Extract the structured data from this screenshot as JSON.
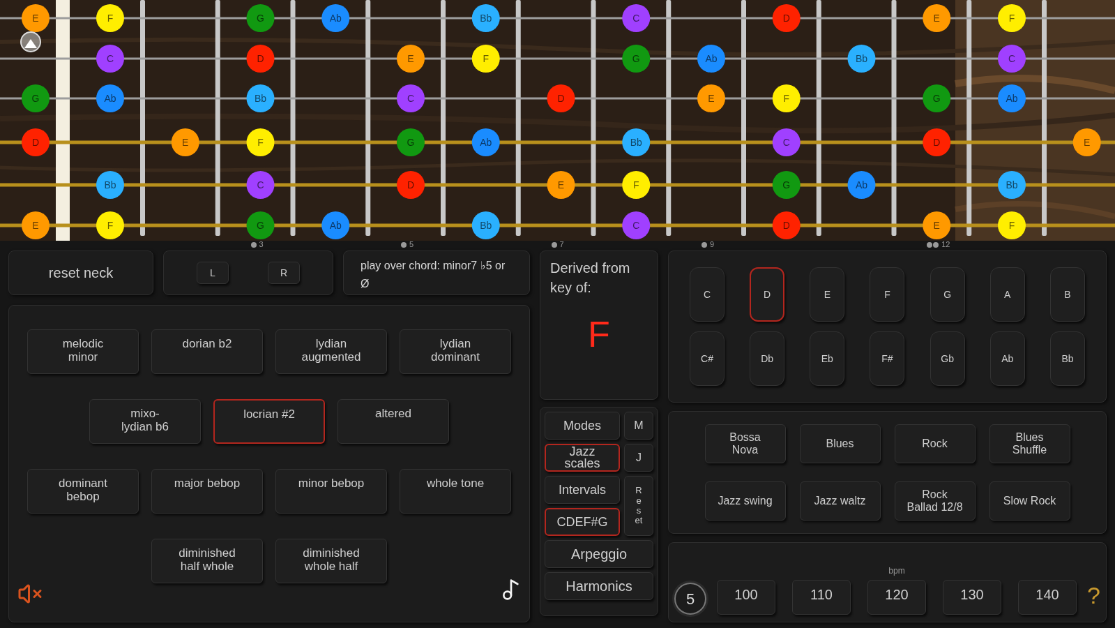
{
  "fretboard": {
    "strings": [
      {
        "kind": "plain",
        "cells": [
          {
            "kind": "note",
            "name": "E",
            "color": "#ff9900"
          },
          {
            "kind": "note",
            "name": "F",
            "color": "#ffee00"
          },
          {
            "kind": "empty"
          },
          {
            "kind": "note",
            "name": "G",
            "color": "#119911"
          },
          {
            "kind": "note",
            "name": "Ab",
            "color": "#1a8cff"
          },
          {
            "kind": "empty"
          },
          {
            "kind": "note",
            "name": "Bb",
            "color": "#2ab0ff"
          },
          {
            "kind": "empty"
          },
          {
            "kind": "note",
            "name": "C",
            "color": "#a040ff"
          },
          {
            "kind": "empty"
          },
          {
            "kind": "note",
            "name": "D",
            "color": "#ff2200"
          },
          {
            "kind": "empty"
          },
          {
            "kind": "note",
            "name": "E",
            "color": "#ff9900"
          },
          {
            "kind": "note",
            "name": "F",
            "color": "#ffee00"
          }
        ]
      },
      {
        "kind": "plain",
        "cells": [
          {
            "kind": "empty"
          },
          {
            "kind": "note",
            "name": "C",
            "color": "#a040ff"
          },
          {
            "kind": "empty"
          },
          {
            "kind": "note",
            "name": "D",
            "color": "#ff2200"
          },
          {
            "kind": "empty"
          },
          {
            "kind": "note",
            "name": "E",
            "color": "#ff9900"
          },
          {
            "kind": "note",
            "name": "F",
            "color": "#ffee00"
          },
          {
            "kind": "empty"
          },
          {
            "kind": "note",
            "name": "G",
            "color": "#119911"
          },
          {
            "kind": "note",
            "name": "Ab",
            "color": "#1a8cff"
          },
          {
            "kind": "empty"
          },
          {
            "kind": "note",
            "name": "Bb",
            "color": "#2ab0ff"
          },
          {
            "kind": "empty"
          },
          {
            "kind": "note",
            "name": "C",
            "color": "#a040ff"
          }
        ]
      },
      {
        "kind": "plain",
        "cells": [
          {
            "kind": "note",
            "name": "G",
            "color": "#119911"
          },
          {
            "kind": "note",
            "name": "Ab",
            "color": "#1a8cff"
          },
          {
            "kind": "empty"
          },
          {
            "kind": "note",
            "name": "Bb",
            "color": "#2ab0ff"
          },
          {
            "kind": "empty"
          },
          {
            "kind": "note",
            "name": "C",
            "color": "#a040ff"
          },
          {
            "kind": "empty"
          },
          {
            "kind": "note",
            "name": "D",
            "color": "#ff2200"
          },
          {
            "kind": "empty"
          },
          {
            "kind": "note",
            "name": "E",
            "color": "#ff9900"
          },
          {
            "kind": "note",
            "name": "F",
            "color": "#ffee00"
          },
          {
            "kind": "empty"
          },
          {
            "kind": "note",
            "name": "G",
            "color": "#119911"
          },
          {
            "kind": "note",
            "name": "Ab",
            "color": "#1a8cff"
          }
        ]
      },
      {
        "kind": "wound",
        "cells": [
          {
            "kind": "note",
            "name": "D",
            "color": "#ff2200"
          },
          {
            "kind": "empty"
          },
          {
            "kind": "note",
            "name": "E",
            "color": "#ff9900"
          },
          {
            "kind": "note",
            "name": "F",
            "color": "#ffee00"
          },
          {
            "kind": "empty"
          },
          {
            "kind": "note",
            "name": "G",
            "color": "#119911"
          },
          {
            "kind": "note",
            "name": "Ab",
            "color": "#1a8cff"
          },
          {
            "kind": "empty"
          },
          {
            "kind": "note",
            "name": "Bb",
            "color": "#2ab0ff"
          },
          {
            "kind": "empty"
          },
          {
            "kind": "note",
            "name": "C",
            "color": "#a040ff"
          },
          {
            "kind": "empty"
          },
          {
            "kind": "note",
            "name": "D",
            "color": "#ff2200"
          },
          {
            "kind": "empty"
          },
          {
            "kind": "note",
            "name": "E",
            "color": "#ff9900"
          }
        ]
      },
      {
        "kind": "wound",
        "cells": [
          {
            "kind": "empty"
          },
          {
            "kind": "note",
            "name": "Bb",
            "color": "#2ab0ff"
          },
          {
            "kind": "empty"
          },
          {
            "kind": "note",
            "name": "C",
            "color": "#a040ff"
          },
          {
            "kind": "empty"
          },
          {
            "kind": "note",
            "name": "D",
            "color": "#ff2200"
          },
          {
            "kind": "empty"
          },
          {
            "kind": "note",
            "name": "E",
            "color": "#ff9900"
          },
          {
            "kind": "note",
            "name": "F",
            "color": "#ffee00"
          },
          {
            "kind": "empty"
          },
          {
            "kind": "note",
            "name": "G",
            "color": "#119911"
          },
          {
            "kind": "note",
            "name": "Ab",
            "color": "#1a8cff"
          },
          {
            "kind": "empty"
          },
          {
            "kind": "note",
            "name": "Bb",
            "color": "#2ab0ff"
          }
        ]
      },
      {
        "kind": "wound",
        "cells": [
          {
            "kind": "note",
            "name": "E",
            "color": "#ff9900"
          },
          {
            "kind": "note",
            "name": "F",
            "color": "#ffee00"
          },
          {
            "kind": "empty"
          },
          {
            "kind": "note",
            "name": "G",
            "color": "#119911"
          },
          {
            "kind": "note",
            "name": "Ab",
            "color": "#1a8cff"
          },
          {
            "kind": "empty"
          },
          {
            "kind": "note",
            "name": "Bb",
            "color": "#2ab0ff"
          },
          {
            "kind": "empty"
          },
          {
            "kind": "note",
            "name": "C",
            "color": "#a040ff"
          },
          {
            "kind": "empty"
          },
          {
            "kind": "note",
            "name": "D",
            "color": "#ff2200"
          },
          {
            "kind": "empty"
          },
          {
            "kind": "note",
            "name": "E",
            "color": "#ff9900"
          },
          {
            "kind": "note",
            "name": "F",
            "color": "#ffee00"
          }
        ]
      }
    ],
    "markers": [
      {
        "kind": "empty"
      },
      {
        "kind": "empty"
      },
      {
        "kind": "empty"
      },
      {
        "kind": "single",
        "label": "3"
      },
      {
        "kind": "empty"
      },
      {
        "kind": "single",
        "label": "5"
      },
      {
        "kind": "empty"
      },
      {
        "kind": "single",
        "label": "7"
      },
      {
        "kind": "empty"
      },
      {
        "kind": "single",
        "label": "9"
      },
      {
        "kind": "empty"
      },
      {
        "kind": "empty"
      },
      {
        "kind": "double",
        "label": "12"
      }
    ]
  },
  "top_controls": {
    "reset_button": "reset neck",
    "hand_buttons": [
      "L",
      "R"
    ],
    "chord_hint": "play over chord: minor7 ♭5 or Ø"
  },
  "scales": [
    {
      "label": "melodic\nminor",
      "selected": false
    },
    {
      "label": "dorian b2",
      "selected": false
    },
    {
      "label": "lydian\naugmented",
      "selected": false
    },
    {
      "label": "lydian\ndominant",
      "selected": false
    },
    {
      "label": "mixo-\nlydian b6",
      "selected": false
    },
    {
      "label": "locrian #2",
      "selected": true
    },
    {
      "label": "altered",
      "selected": false
    },
    {
      "label": "dominant\nbebop",
      "selected": false
    },
    {
      "label": "major bebop",
      "selected": false
    },
    {
      "label": "minor bebop",
      "selected": false
    },
    {
      "label": "whole tone",
      "selected": false
    },
    {
      "label": "diminished\nhalf whole",
      "selected": false
    },
    {
      "label": "diminished\nwhole half",
      "selected": false
    }
  ],
  "derived": {
    "label": "Derived from key of:",
    "key": "F"
  },
  "keys": {
    "rows": [
      [
        {
          "label": "C",
          "selected": false
        },
        {
          "label": "D",
          "selected": true
        },
        {
          "label": "E",
          "selected": false
        },
        {
          "label": "F",
          "selected": false
        },
        {
          "label": "G",
          "selected": false
        },
        {
          "label": "A",
          "selected": false
        },
        {
          "label": "B",
          "selected": false
        }
      ],
      [
        {
          "label": "C#",
          "selected": false
        },
        {
          "label": "Db",
          "selected": false
        },
        {
          "label": "Eb",
          "selected": false
        },
        {
          "label": "F#",
          "selected": false
        },
        {
          "label": "Gb",
          "selected": false
        },
        {
          "label": "Ab",
          "selected": false
        },
        {
          "label": "Bb",
          "selected": false
        }
      ]
    ]
  },
  "categories": [
    {
      "label": "Modes",
      "selected": false
    },
    {
      "label": "Jazz\nscales",
      "selected": true
    },
    {
      "label": "Intervals",
      "selected": false
    },
    {
      "label": "CDEF#G",
      "selected": true
    }
  ],
  "category_shortcuts": [
    "M",
    "J"
  ],
  "reset_side_button": "Reset",
  "extra_buttons": [
    "Arpeggio",
    "Harmonics"
  ],
  "rhythms": {
    "rows": [
      [
        "Bossa\nNova",
        "Blues",
        "Rock",
        "Blues\nShuffle"
      ],
      [
        "Jazz swing",
        "Jazz waltz",
        "Rock\nBallad 12/8",
        "Slow Rock"
      ]
    ]
  },
  "tempo": {
    "label": "bpm",
    "options": [
      "100",
      "110",
      "120",
      "130",
      "140"
    ],
    "count": "5"
  },
  "help": "?"
}
